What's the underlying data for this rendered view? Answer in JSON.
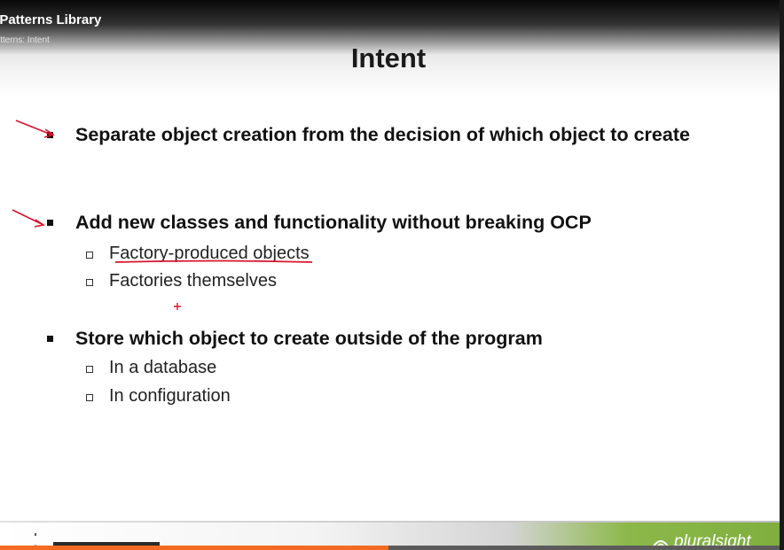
{
  "player": {
    "course_title": "n Patterns Library",
    "clip_title": "Patterns: Intent",
    "progress_fraction": 0.495,
    "progress_color": "#f26b21"
  },
  "slide": {
    "title": "Intent",
    "bullets": [
      {
        "text": "Separate object creation from the decision of which object to create",
        "sub": []
      },
      {
        "text": "Add new classes and functionality without breaking OCP",
        "sub": [
          "Factory-produced objects",
          "Factories themselves"
        ]
      },
      {
        "text": "Store which object to create outside of the program",
        "sub": [
          "In a database",
          "In configuration"
        ]
      }
    ]
  },
  "footer": {
    "brand_right": "pluralsight",
    "accent_color": "#7fae3f"
  },
  "annotations": {
    "ink_color": "#d9142b"
  }
}
